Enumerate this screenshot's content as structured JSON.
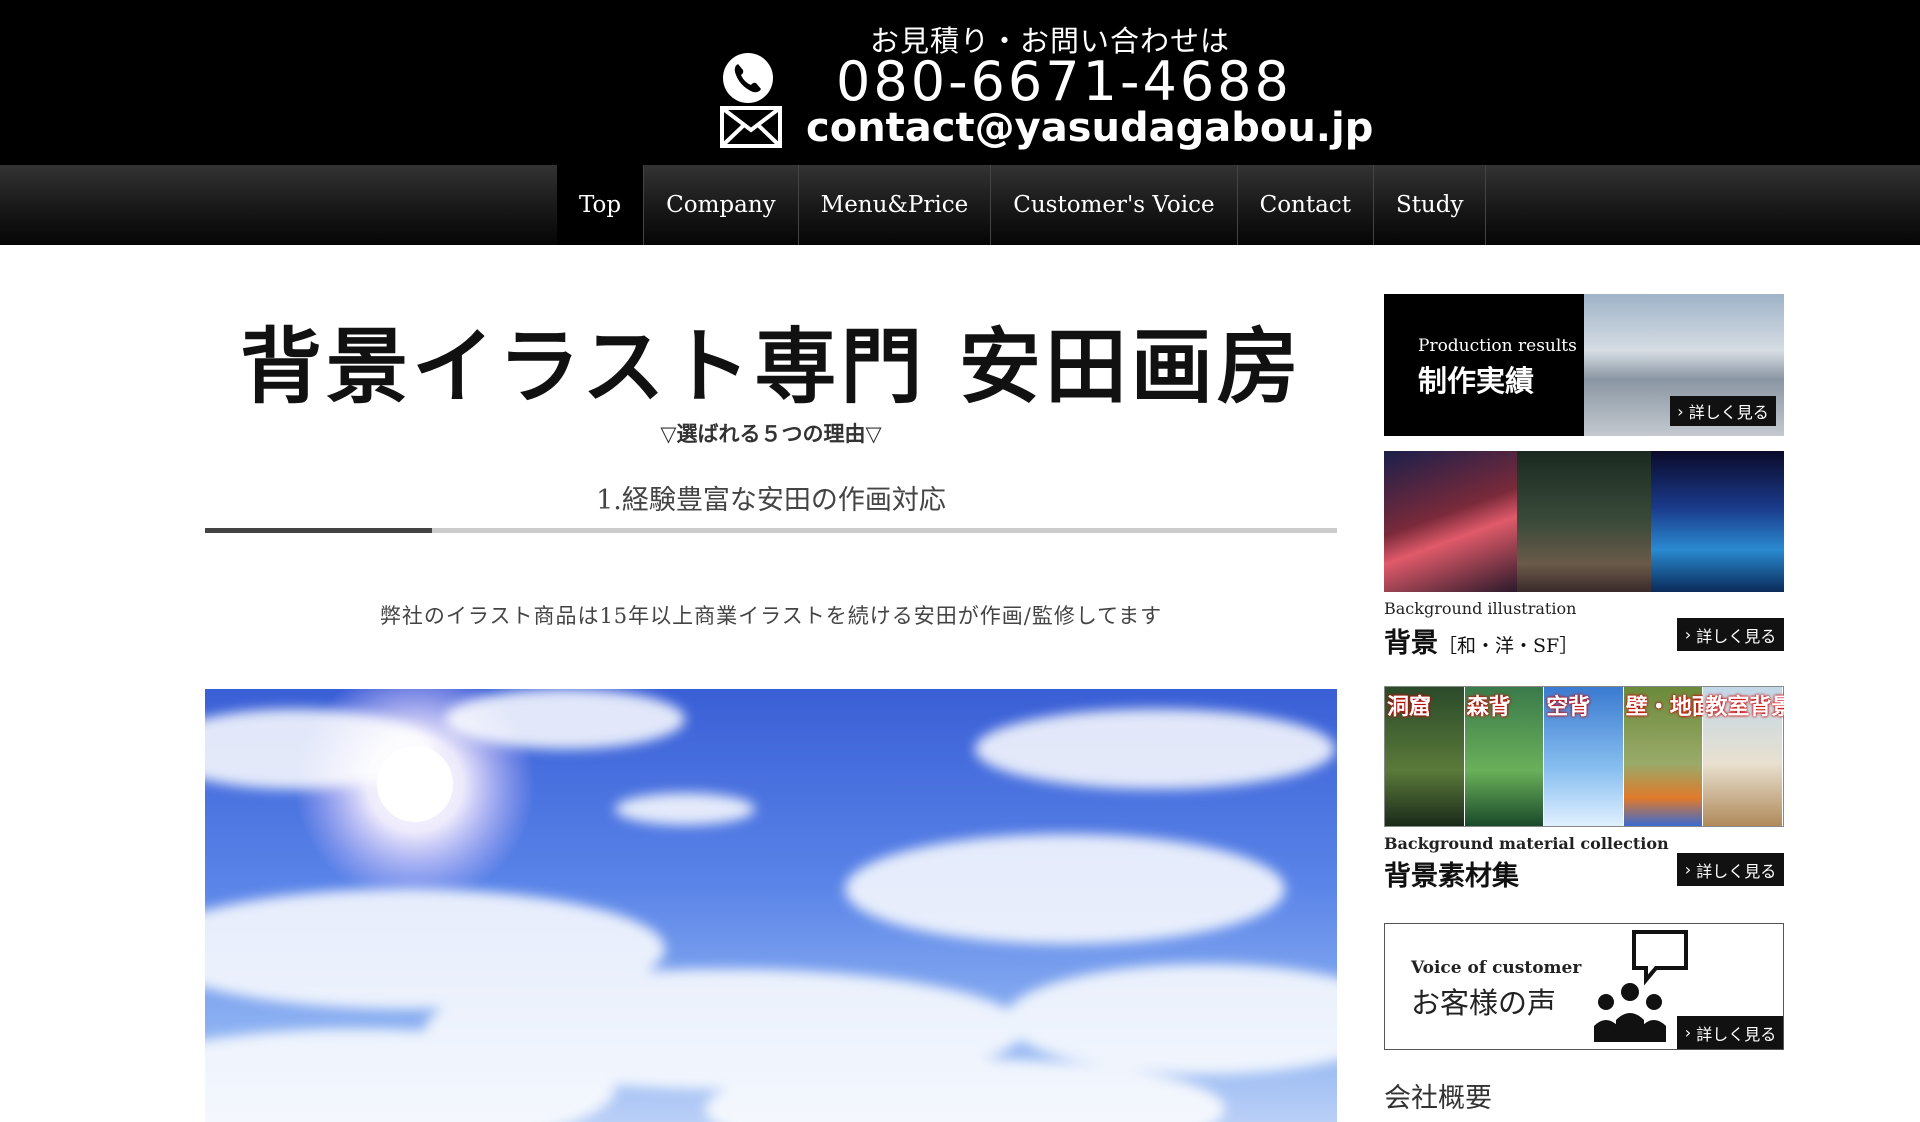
{
  "header": {
    "inquiry_label": "お見積り・お問い合わせは",
    "phone": "080-6671-4688",
    "email": "contact@yasudagabou.jp",
    "phone_icon": "phone-icon",
    "mail_icon": "mail-icon"
  },
  "nav": {
    "items": [
      {
        "label": "Top",
        "active": true
      },
      {
        "label": "Company"
      },
      {
        "label": "Menu&Price"
      },
      {
        "label": "Customer's Voice"
      },
      {
        "label": "Contact"
      },
      {
        "label": "Study"
      }
    ]
  },
  "main": {
    "brand_title": "背景イラスト専門 安田画房",
    "reasons_heading": "▽選ばれる５つの理由▽",
    "section_title": "1.経験豊富な安田の作画対応",
    "section_description": "弊社のイラスト商品は15年以上商業イラストを続ける安田が作画/監修してます"
  },
  "sidebar": {
    "detail_label": "詳しく見る",
    "production": {
      "en": "Production results",
      "jp": "制作実績"
    },
    "background": {
      "en": "Background illustration",
      "jp": "背景",
      "sub": "［和・洋・SF］"
    },
    "material": {
      "en": "Background material collection",
      "jp": "背景素材集",
      "thumb_labels": [
        "洞窟",
        "森背",
        "空背",
        "壁・地面",
        "教室背景"
      ]
    },
    "voice": {
      "en": "Voice of customer",
      "jp": "お客様の声"
    },
    "company_heading": "会社概要"
  },
  "colors": {
    "header_bg": "#000000",
    "nav_bg": "#1a1a1a",
    "accent_rule": "#444444",
    "button_bg": "#111111"
  }
}
